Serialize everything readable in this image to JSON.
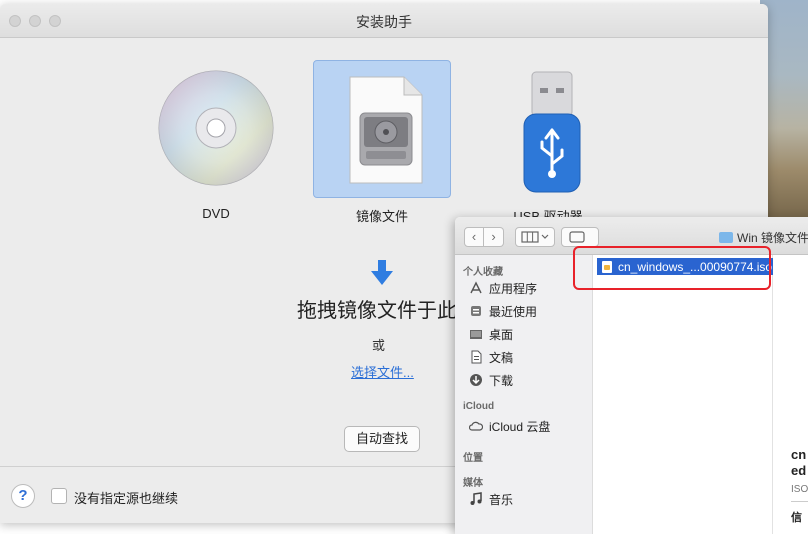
{
  "window": {
    "title": "安装助手"
  },
  "sources": [
    {
      "label": "DVD",
      "icon": "dvd-disc-icon"
    },
    {
      "label": "镜像文件",
      "icon": "disk-image-icon",
      "selected": true
    },
    {
      "label": "USB 驱动器",
      "icon": "usb-drive-icon"
    }
  ],
  "main": {
    "drag_text": "拖拽镜像文件于此",
    "or_text": "或",
    "choose_file": "选择文件...",
    "auto_find": "自动查找"
  },
  "footer": {
    "help": "?",
    "continue_label": "没有指定源也继续"
  },
  "finder": {
    "back": "‹",
    "forward": "›",
    "path": "Win 镜像文件",
    "sidebar": {
      "favorites_title": "个人收藏",
      "favorites": [
        "应用程序",
        "最近使用",
        "桌面",
        "文稿",
        "下载"
      ],
      "icloud_title": "iCloud",
      "icloud": [
        "iCloud 云盘"
      ],
      "location_title": "位置",
      "media_title": "媒体",
      "media": [
        "音乐"
      ]
    },
    "selected_file": "cn_windows_...00090774.iso",
    "preview": {
      "name_line1": "cn",
      "name_line2": "ed",
      "kind": "ISO",
      "info": "信"
    }
  },
  "colors": {
    "selection": "#2a64d0",
    "highlight_box": "#e8222a",
    "link": "#2a6ed6",
    "arrow": "#2f7de1"
  }
}
